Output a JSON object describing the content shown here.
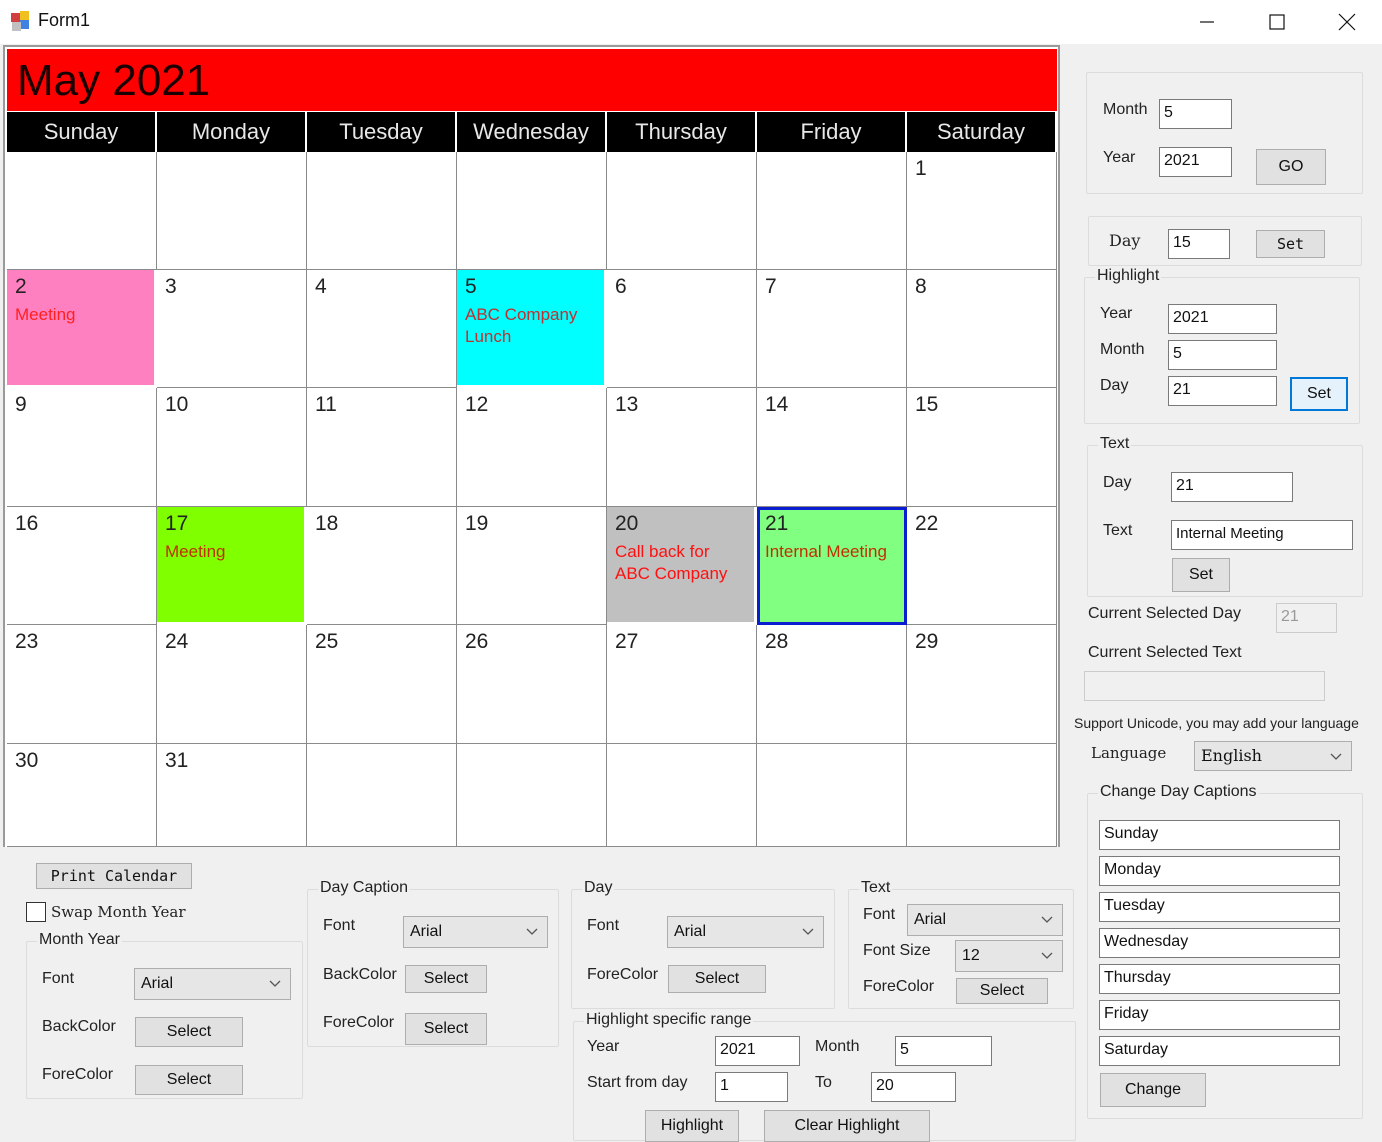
{
  "window": {
    "title": "Form1",
    "controls": [
      "minimize",
      "maximize",
      "close"
    ]
  },
  "calendar": {
    "header": "May 2021",
    "header_bg": "#ff0000",
    "day_captions": [
      "Sunday",
      "Monday",
      "Tuesday",
      "Wednesday",
      "Thursday",
      "Friday",
      "Saturday"
    ],
    "first_weekday_index": 6,
    "days_in_month": 31,
    "events": {
      "2": {
        "text": "Meeting",
        "bg": "#ff80c0",
        "fg": "#ff2020"
      },
      "5": {
        "text": "ABC Company Lunch",
        "bg": "#00ffff",
        "fg": "#c03030"
      },
      "17": {
        "text": "Meeting",
        "bg": "#80ff00",
        "fg": "#c03000"
      },
      "20": {
        "text": "Call back for ABC Company",
        "bg": "#c0c0c0",
        "fg": "#ff1010"
      },
      "21": {
        "text": "Internal Meeting",
        "bg": "#80ff80",
        "fg": "#c03000"
      }
    },
    "selected_day": 21,
    "selected_border": "#0a1ed0"
  },
  "nav": {
    "month_label": "Month",
    "month_value": "5",
    "year_label": "Year",
    "year_value": "2021",
    "go_label": "GO"
  },
  "day_set": {
    "day_label": "Day",
    "day_value": "15",
    "set_label": "Set"
  },
  "highlight": {
    "legend": "Highlight",
    "year_label": "Year",
    "year_value": "2021",
    "month_label": "Month",
    "month_value": "5",
    "day_label": "Day",
    "day_value": "21",
    "set_label": "Set"
  },
  "text_group": {
    "legend": "Text",
    "day_label": "Day",
    "day_value": "21",
    "text_label": "Text",
    "text_value": "Internal Meeting",
    "set_label": "Set"
  },
  "current": {
    "selected_day_label": "Current Selected Day",
    "selected_day_value": "21",
    "selected_text_label": "Current Selected Text",
    "selected_text_value": ""
  },
  "language": {
    "note": "Support Unicode, you may add your language",
    "label": "Language",
    "value": "English"
  },
  "change_captions": {
    "legend": "Change Day Captions",
    "values": [
      "Sunday",
      "Monday",
      "Tuesday",
      "Wednesday",
      "Thursday",
      "Friday",
      "Saturday"
    ],
    "change_label": "Change"
  },
  "bottom": {
    "print_label": "Print Calendar",
    "swap_label": "Swap Month Year",
    "swap_checked": false,
    "month_year": {
      "legend": "Month Year",
      "font_label": "Font",
      "font_value": "Arial",
      "backcolor_label": "BackColor",
      "backcolor_button": "Select",
      "forecolor_label": "ForeColor",
      "forecolor_button": "Select"
    },
    "day_caption": {
      "legend": "Day Caption",
      "font_label": "Font",
      "font_value": "Arial",
      "backcolor_label": "BackColor",
      "backcolor_button": "Select",
      "forecolor_label": "ForeColor",
      "forecolor_button": "Select"
    },
    "day": {
      "legend": "Day",
      "font_label": "Font",
      "font_value": "Arial",
      "forecolor_label": "ForeColor",
      "forecolor_button": "Select"
    },
    "text": {
      "legend": "Text",
      "font_label": "Font",
      "font_value": "Arial",
      "fontsize_label": "Font Size",
      "fontsize_value": "12",
      "forecolor_label": "ForeColor",
      "forecolor_button": "Select"
    },
    "range": {
      "legend": "Highlight specific range",
      "year_label": "Year",
      "year_value": "2021",
      "month_label": "Month",
      "month_value": "5",
      "start_label": "Start from day",
      "start_value": "1",
      "to_label": "To",
      "to_value": "20",
      "highlight_label": "Highlight",
      "clear_label": "Clear Highlight"
    }
  }
}
